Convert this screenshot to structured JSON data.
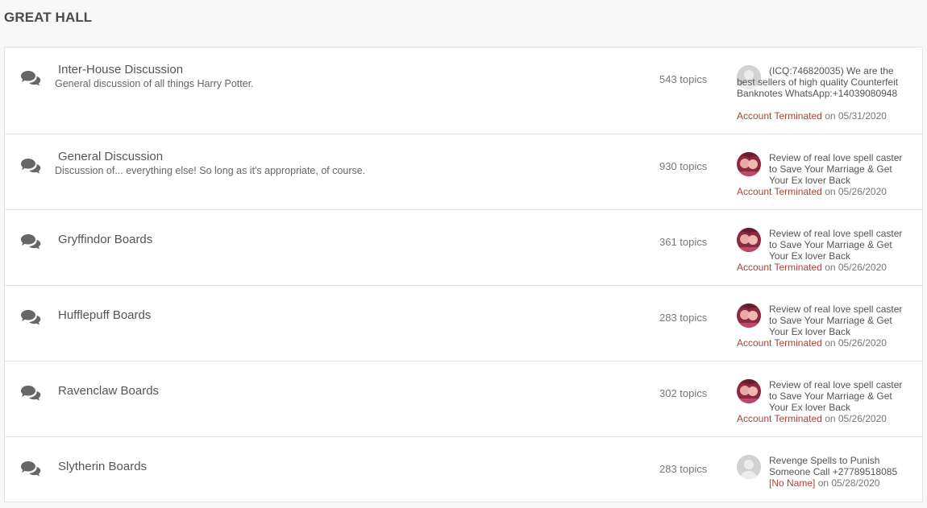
{
  "section": {
    "title": "GREAT HALL"
  },
  "forums": [
    {
      "title": "Inter-House Discussion",
      "description": "General discussion of all things Harry Potter.",
      "topics": "543 topics",
      "last_post": {
        "title": "(ICQ:746820035) We are the best sellers of high quality Counterfeit Banknotes WhatsApp:+14039080948",
        "author": "Account Terminated",
        "date_text": "on 05/31/2020",
        "avatar": "default-avatar"
      }
    },
    {
      "title": "General Discussion",
      "description": "Discussion of... everything else! So long as it's appropriate, of course.",
      "topics": "930 topics",
      "last_post": {
        "title": "Review of real love spell caster to Save Your Marriage & Get Your Ex lover Back",
        "author": "Account Terminated",
        "date_text": "on 05/26/2020",
        "avatar": "photo-avatar"
      }
    },
    {
      "title": "Gryffindor Boards",
      "description": "",
      "topics": "361 topics",
      "last_post": {
        "title": "Review of real love spell caster to Save Your Marriage & Get Your Ex lover Back",
        "author": "Account Terminated",
        "date_text": "on 05/26/2020",
        "avatar": "photo-avatar"
      }
    },
    {
      "title": "Hufflepuff Boards",
      "description": "",
      "topics": "283 topics",
      "last_post": {
        "title": "Review of real love spell caster to Save Your Marriage & Get Your Ex lover Back",
        "author": "Account Terminated",
        "date_text": "on 05/26/2020",
        "avatar": "photo-avatar"
      }
    },
    {
      "title": "Ravenclaw Boards",
      "description": "",
      "topics": "302 topics",
      "last_post": {
        "title": "Review of real love spell caster to Save Your Marriage & Get Your Ex lover Back",
        "author": "Account Terminated",
        "date_text": "on 05/26/2020",
        "avatar": "photo-avatar"
      }
    },
    {
      "title": "Slytherin Boards",
      "description": "",
      "topics": "283 topics",
      "last_post": {
        "title": "Revenge Spells to Punish Someone Call +27789518085",
        "author": "[No Name]",
        "date_text": "on 05/28/2020",
        "avatar": "default-avatar"
      }
    }
  ],
  "colors": {
    "author_link": "#a8453a",
    "icon": "#666666",
    "border": "#e5e5e5"
  },
  "icons": {
    "forum": "chat-bubbles-icon"
  }
}
